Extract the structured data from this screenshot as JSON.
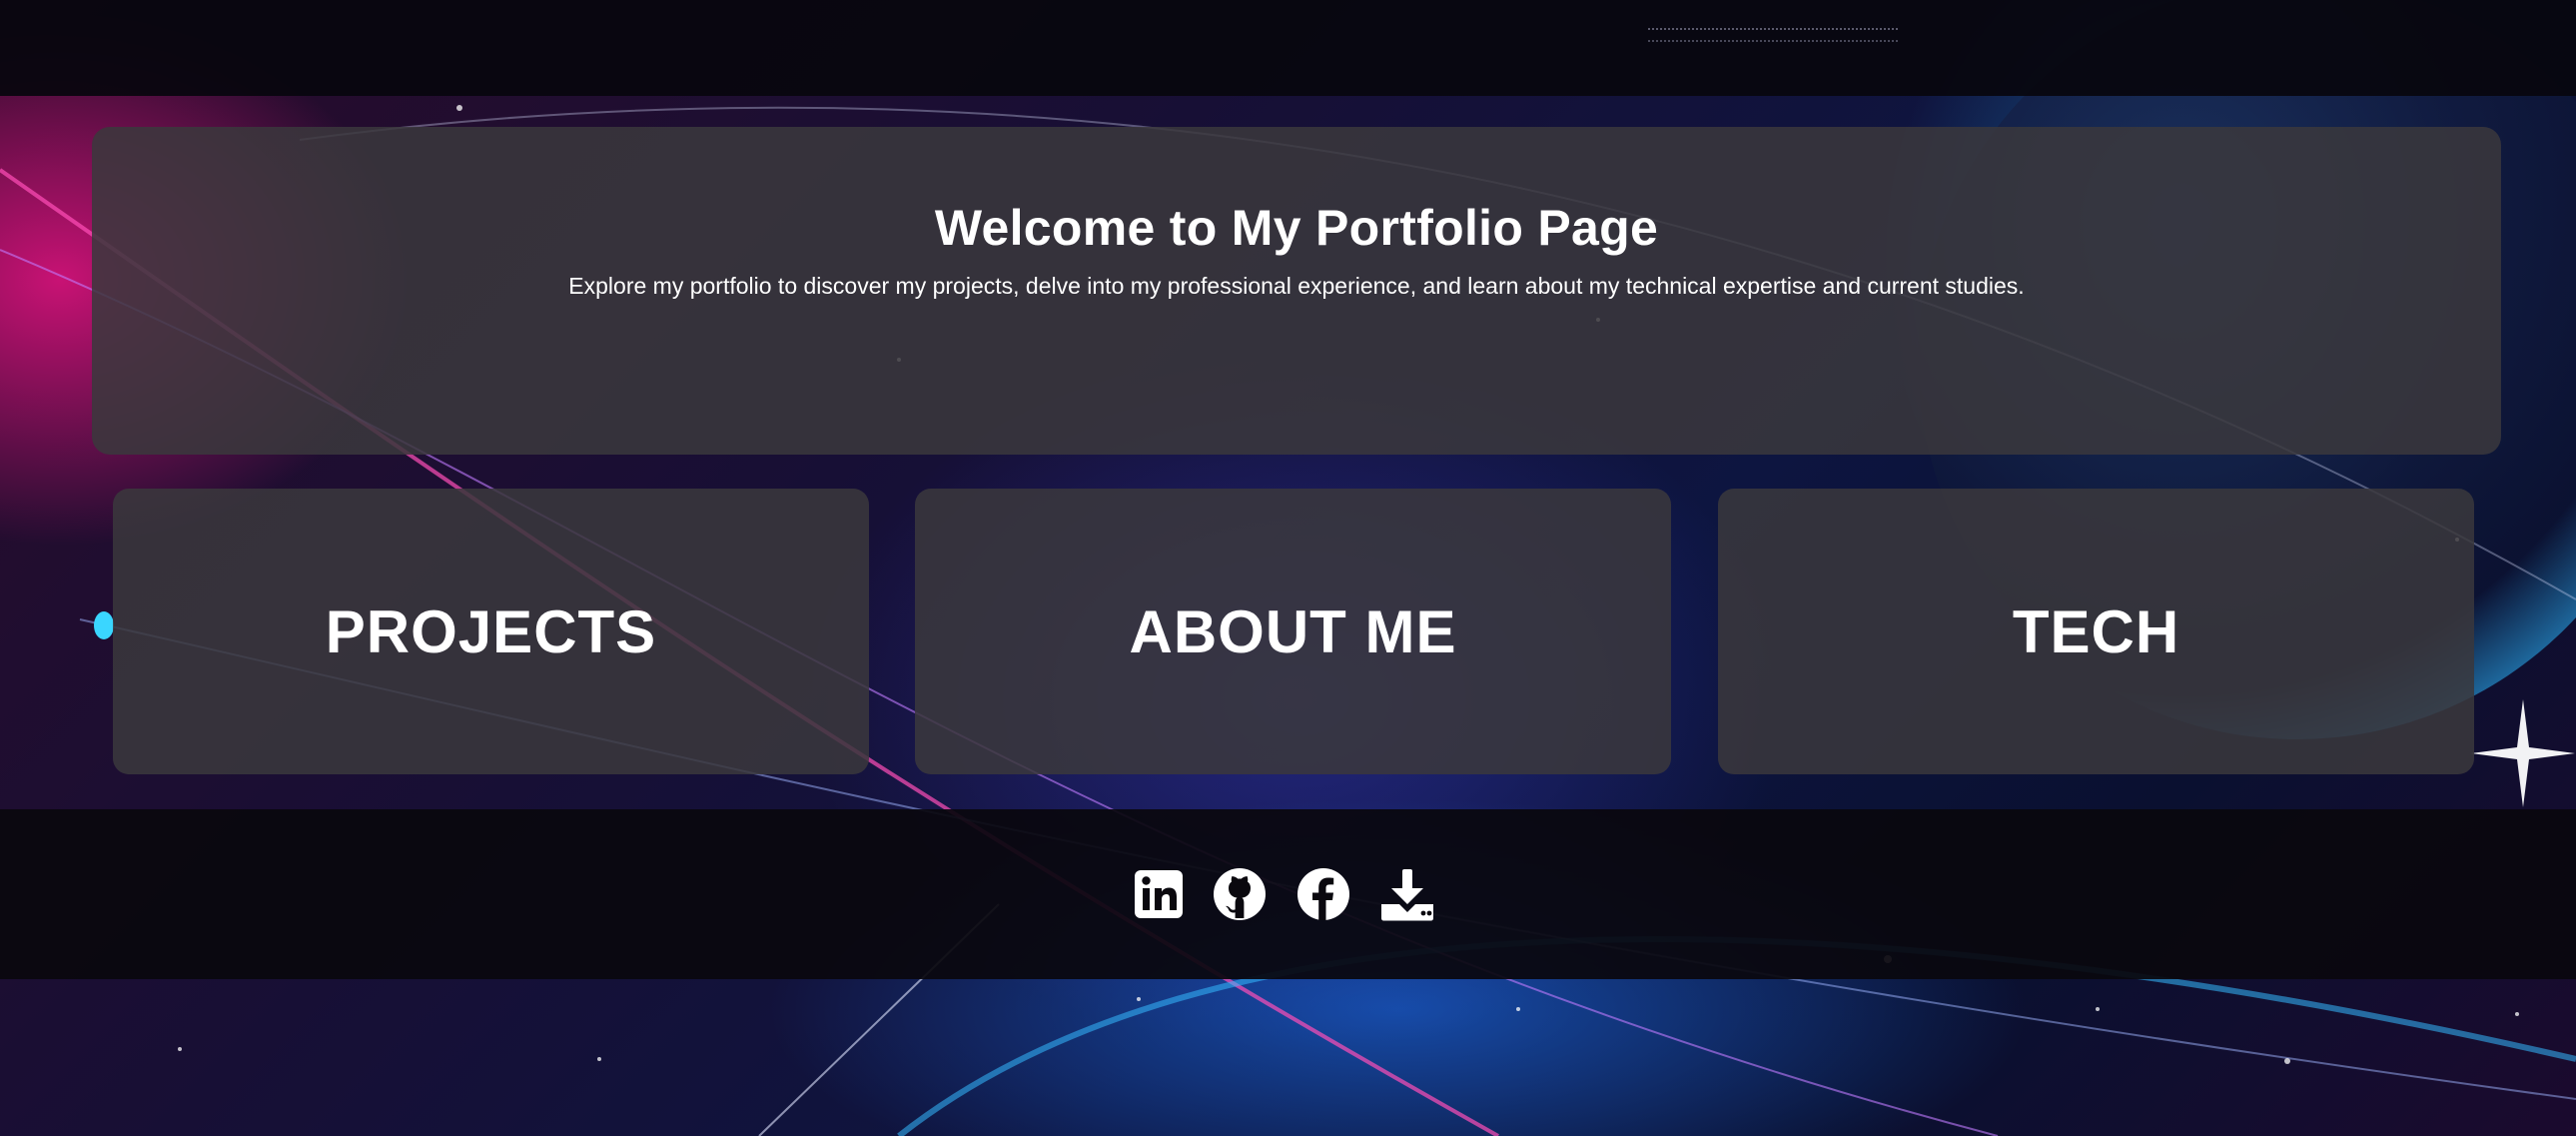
{
  "hero": {
    "title": "Welcome to My Portfolio Page",
    "subtitle": "Explore my portfolio to discover my projects, delve into my professional experience, and learn about my technical expertise and current studies."
  },
  "nav_cards": [
    {
      "label": "PROJECTS"
    },
    {
      "label": "ABOUT ME"
    },
    {
      "label": "TECH"
    }
  ],
  "footer": {
    "social_links": [
      {
        "icon": "linkedin-icon"
      },
      {
        "icon": "github-icon"
      },
      {
        "icon": "facebook-icon"
      },
      {
        "icon": "download-icon"
      }
    ]
  },
  "colors": {
    "panel": "#3a383c",
    "bar": "#0a080e",
    "text": "#ffffff",
    "accent_pink": "#ff148c",
    "accent_blue": "#1e78ff"
  }
}
